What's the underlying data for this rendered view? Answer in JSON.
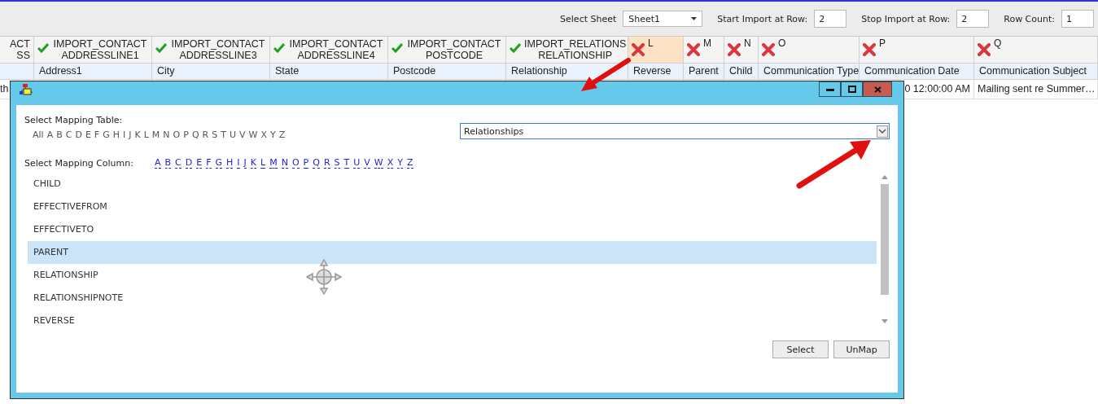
{
  "toolbar": {
    "fields": [
      {
        "kind": "dropdown",
        "label": "Select Sheet",
        "value": "Sheet1"
      },
      {
        "kind": "input",
        "label": "Start Import at Row:",
        "value": "2"
      },
      {
        "kind": "input",
        "label": "Stop Import at Row:",
        "value": "2"
      },
      {
        "kind": "input",
        "label": "Row Count:",
        "value": "1"
      }
    ]
  },
  "grid": {
    "columns": [
      {
        "lines": [
          "ACT",
          "SS"
        ],
        "cell": "th"
      },
      {
        "mapped": true,
        "lines": [
          "IMPORT_CONTACT",
          "ADDRESSLINE1"
        ],
        "field": "Address1"
      },
      {
        "mapped": true,
        "lines": [
          "IMPORT_CONTACT",
          "ADDRESSLINE3"
        ],
        "field": "City"
      },
      {
        "mapped": true,
        "lines": [
          "IMPORT_CONTACT",
          "ADDRESSLINE4"
        ],
        "field": "State"
      },
      {
        "mapped": true,
        "lines": [
          "IMPORT_CONTACT",
          "POSTCODE"
        ],
        "field": "Postcode"
      },
      {
        "mapped": true,
        "lines": [
          "IMPORT_RELATIONS",
          "RELATIONSHIP"
        ],
        "field": "Relationship"
      },
      {
        "mapped": false,
        "letter": "L",
        "selected": true,
        "field": "Reverse"
      },
      {
        "mapped": false,
        "letter": "M",
        "selected": false,
        "field": "Parent"
      },
      {
        "mapped": false,
        "letter": "N",
        "selected": false,
        "field": "Child"
      },
      {
        "mapped": false,
        "letter": "O",
        "selected": false,
        "field": "Communication Type"
      },
      {
        "mapped": false,
        "letter": "P",
        "selected": false,
        "field": "Communication Date",
        "cell": "0 12:00:00 AM"
      },
      {
        "mapped": false,
        "letter": "Q",
        "selected": false,
        "field": "Communication Subject",
        "cell": "Mailing sent re Summer…"
      }
    ]
  },
  "dialog": {
    "table_label": "Select Mapping Table:",
    "table_letters": [
      "All",
      "A",
      "B",
      "C",
      "D",
      "E",
      "F",
      "G",
      "H",
      "I",
      "J",
      "K",
      "L",
      "M",
      "N",
      "O",
      "P",
      "Q",
      "R",
      "S",
      "T",
      "U",
      "V",
      "W",
      "X",
      "Y",
      "Z"
    ],
    "table_value": "Relationships",
    "column_label": "Select Mapping Column:",
    "column_letters": [
      "A",
      "B",
      "C",
      "D",
      "E",
      "F",
      "G",
      "H",
      "I",
      "J",
      "K",
      "L",
      "M",
      "N",
      "O",
      "P",
      "Q",
      "R",
      "S",
      "T",
      "U",
      "V",
      "W",
      "X",
      "Y",
      "Z"
    ],
    "items": [
      {
        "label": "CHILD",
        "selected": false
      },
      {
        "label": "EFFECTIVEFROM",
        "selected": false
      },
      {
        "label": "EFFECTIVETO",
        "selected": false
      },
      {
        "label": "PARENT",
        "selected": true
      },
      {
        "label": "RELATIONSHIP",
        "selected": false
      },
      {
        "label": "RELATIONSHIPNOTE",
        "selected": false
      },
      {
        "label": "REVERSE",
        "selected": false
      }
    ],
    "buttons": [
      "Select",
      "UnMap"
    ]
  }
}
